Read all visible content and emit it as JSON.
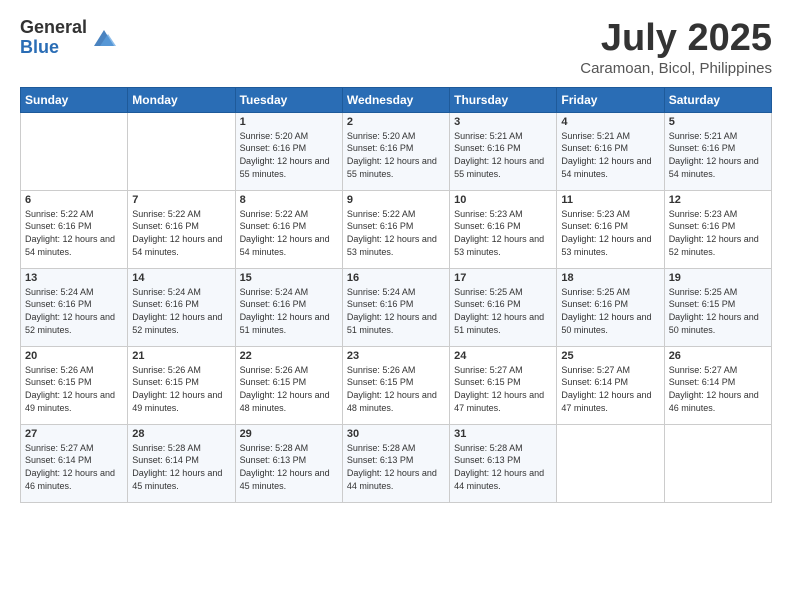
{
  "logo": {
    "general": "General",
    "blue": "Blue"
  },
  "header": {
    "month": "July 2025",
    "location": "Caramoan, Bicol, Philippines"
  },
  "days_of_week": [
    "Sunday",
    "Monday",
    "Tuesday",
    "Wednesday",
    "Thursday",
    "Friday",
    "Saturday"
  ],
  "weeks": [
    [
      {
        "day": "",
        "sunrise": "",
        "sunset": "",
        "daylight": ""
      },
      {
        "day": "",
        "sunrise": "",
        "sunset": "",
        "daylight": ""
      },
      {
        "day": "1",
        "sunrise": "Sunrise: 5:20 AM",
        "sunset": "Sunset: 6:16 PM",
        "daylight": "Daylight: 12 hours and 55 minutes."
      },
      {
        "day": "2",
        "sunrise": "Sunrise: 5:20 AM",
        "sunset": "Sunset: 6:16 PM",
        "daylight": "Daylight: 12 hours and 55 minutes."
      },
      {
        "day": "3",
        "sunrise": "Sunrise: 5:21 AM",
        "sunset": "Sunset: 6:16 PM",
        "daylight": "Daylight: 12 hours and 55 minutes."
      },
      {
        "day": "4",
        "sunrise": "Sunrise: 5:21 AM",
        "sunset": "Sunset: 6:16 PM",
        "daylight": "Daylight: 12 hours and 54 minutes."
      },
      {
        "day": "5",
        "sunrise": "Sunrise: 5:21 AM",
        "sunset": "Sunset: 6:16 PM",
        "daylight": "Daylight: 12 hours and 54 minutes."
      }
    ],
    [
      {
        "day": "6",
        "sunrise": "Sunrise: 5:22 AM",
        "sunset": "Sunset: 6:16 PM",
        "daylight": "Daylight: 12 hours and 54 minutes."
      },
      {
        "day": "7",
        "sunrise": "Sunrise: 5:22 AM",
        "sunset": "Sunset: 6:16 PM",
        "daylight": "Daylight: 12 hours and 54 minutes."
      },
      {
        "day": "8",
        "sunrise": "Sunrise: 5:22 AM",
        "sunset": "Sunset: 6:16 PM",
        "daylight": "Daylight: 12 hours and 54 minutes."
      },
      {
        "day": "9",
        "sunrise": "Sunrise: 5:22 AM",
        "sunset": "Sunset: 6:16 PM",
        "daylight": "Daylight: 12 hours and 53 minutes."
      },
      {
        "day": "10",
        "sunrise": "Sunrise: 5:23 AM",
        "sunset": "Sunset: 6:16 PM",
        "daylight": "Daylight: 12 hours and 53 minutes."
      },
      {
        "day": "11",
        "sunrise": "Sunrise: 5:23 AM",
        "sunset": "Sunset: 6:16 PM",
        "daylight": "Daylight: 12 hours and 53 minutes."
      },
      {
        "day": "12",
        "sunrise": "Sunrise: 5:23 AM",
        "sunset": "Sunset: 6:16 PM",
        "daylight": "Daylight: 12 hours and 52 minutes."
      }
    ],
    [
      {
        "day": "13",
        "sunrise": "Sunrise: 5:24 AM",
        "sunset": "Sunset: 6:16 PM",
        "daylight": "Daylight: 12 hours and 52 minutes."
      },
      {
        "day": "14",
        "sunrise": "Sunrise: 5:24 AM",
        "sunset": "Sunset: 6:16 PM",
        "daylight": "Daylight: 12 hours and 52 minutes."
      },
      {
        "day": "15",
        "sunrise": "Sunrise: 5:24 AM",
        "sunset": "Sunset: 6:16 PM",
        "daylight": "Daylight: 12 hours and 51 minutes."
      },
      {
        "day": "16",
        "sunrise": "Sunrise: 5:24 AM",
        "sunset": "Sunset: 6:16 PM",
        "daylight": "Daylight: 12 hours and 51 minutes."
      },
      {
        "day": "17",
        "sunrise": "Sunrise: 5:25 AM",
        "sunset": "Sunset: 6:16 PM",
        "daylight": "Daylight: 12 hours and 51 minutes."
      },
      {
        "day": "18",
        "sunrise": "Sunrise: 5:25 AM",
        "sunset": "Sunset: 6:16 PM",
        "daylight": "Daylight: 12 hours and 50 minutes."
      },
      {
        "day": "19",
        "sunrise": "Sunrise: 5:25 AM",
        "sunset": "Sunset: 6:15 PM",
        "daylight": "Daylight: 12 hours and 50 minutes."
      }
    ],
    [
      {
        "day": "20",
        "sunrise": "Sunrise: 5:26 AM",
        "sunset": "Sunset: 6:15 PM",
        "daylight": "Daylight: 12 hours and 49 minutes."
      },
      {
        "day": "21",
        "sunrise": "Sunrise: 5:26 AM",
        "sunset": "Sunset: 6:15 PM",
        "daylight": "Daylight: 12 hours and 49 minutes."
      },
      {
        "day": "22",
        "sunrise": "Sunrise: 5:26 AM",
        "sunset": "Sunset: 6:15 PM",
        "daylight": "Daylight: 12 hours and 48 minutes."
      },
      {
        "day": "23",
        "sunrise": "Sunrise: 5:26 AM",
        "sunset": "Sunset: 6:15 PM",
        "daylight": "Daylight: 12 hours and 48 minutes."
      },
      {
        "day": "24",
        "sunrise": "Sunrise: 5:27 AM",
        "sunset": "Sunset: 6:15 PM",
        "daylight": "Daylight: 12 hours and 47 minutes."
      },
      {
        "day": "25",
        "sunrise": "Sunrise: 5:27 AM",
        "sunset": "Sunset: 6:14 PM",
        "daylight": "Daylight: 12 hours and 47 minutes."
      },
      {
        "day": "26",
        "sunrise": "Sunrise: 5:27 AM",
        "sunset": "Sunset: 6:14 PM",
        "daylight": "Daylight: 12 hours and 46 minutes."
      }
    ],
    [
      {
        "day": "27",
        "sunrise": "Sunrise: 5:27 AM",
        "sunset": "Sunset: 6:14 PM",
        "daylight": "Daylight: 12 hours and 46 minutes."
      },
      {
        "day": "28",
        "sunrise": "Sunrise: 5:28 AM",
        "sunset": "Sunset: 6:14 PM",
        "daylight": "Daylight: 12 hours and 45 minutes."
      },
      {
        "day": "29",
        "sunrise": "Sunrise: 5:28 AM",
        "sunset": "Sunset: 6:13 PM",
        "daylight": "Daylight: 12 hours and 45 minutes."
      },
      {
        "day": "30",
        "sunrise": "Sunrise: 5:28 AM",
        "sunset": "Sunset: 6:13 PM",
        "daylight": "Daylight: 12 hours and 44 minutes."
      },
      {
        "day": "31",
        "sunrise": "Sunrise: 5:28 AM",
        "sunset": "Sunset: 6:13 PM",
        "daylight": "Daylight: 12 hours and 44 minutes."
      },
      {
        "day": "",
        "sunrise": "",
        "sunset": "",
        "daylight": ""
      },
      {
        "day": "",
        "sunrise": "",
        "sunset": "",
        "daylight": ""
      }
    ]
  ]
}
